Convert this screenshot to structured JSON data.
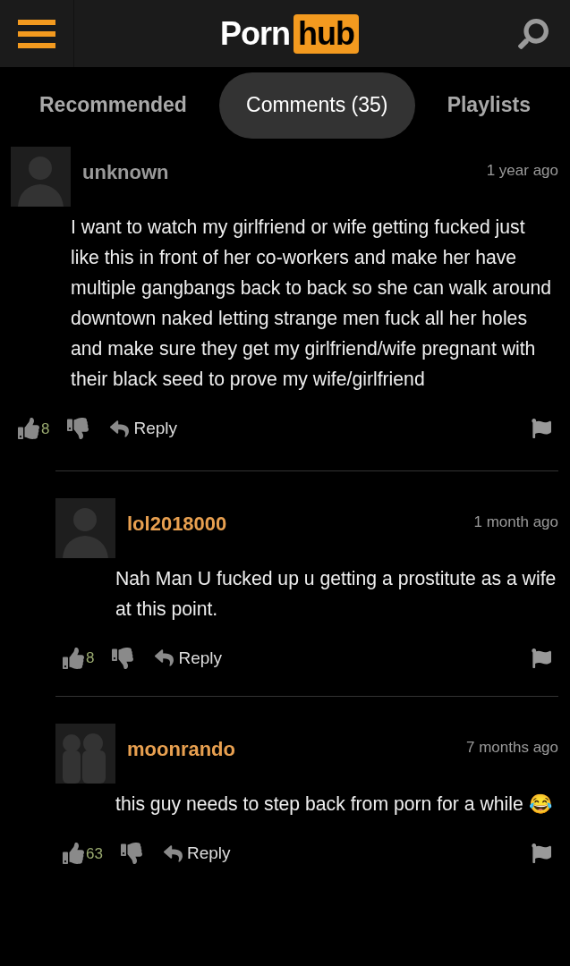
{
  "header": {
    "logo": {
      "text": "Porn",
      "badge": "hub"
    }
  },
  "tabs": [
    {
      "label": "Recommended",
      "selected": false
    },
    {
      "label": "Comments (35)",
      "selected": true
    },
    {
      "label": "Playlists",
      "selected": false
    }
  ],
  "comments": [
    {
      "kind": "top",
      "avatar": {
        "kind": "single"
      },
      "username": "unknown",
      "color": "#9a9a9a",
      "time": "1 year ago",
      "text": "I want to watch my girlfriend or wife getting fucked just like this in front of her co-workers and make her have multiple gangbangs back to back so she can walk around downtown naked letting strange men fuck all her holes and make sure they get my girlfriend/wife pregnant with their black seed to prove my wife/girlfriend",
      "likes": "8",
      "reply": "Reply"
    },
    {
      "kind": "reply",
      "avatar": {
        "kind": "single"
      },
      "username": "lol2018000",
      "color": "#e8a050",
      "time": "1 month ago",
      "text": "Nah Man U fucked up u getting a prostitute as a wife at this point.",
      "likes": "8",
      "reply": "Reply"
    },
    {
      "kind": "reply",
      "avatar": {
        "kind": "group"
      },
      "username": "moonrando",
      "color": "#e8a050",
      "time": "7 months ago",
      "text": "this guy needs to step back from porn for a while 😂",
      "likes": "63",
      "reply": "Reply"
    }
  ]
}
